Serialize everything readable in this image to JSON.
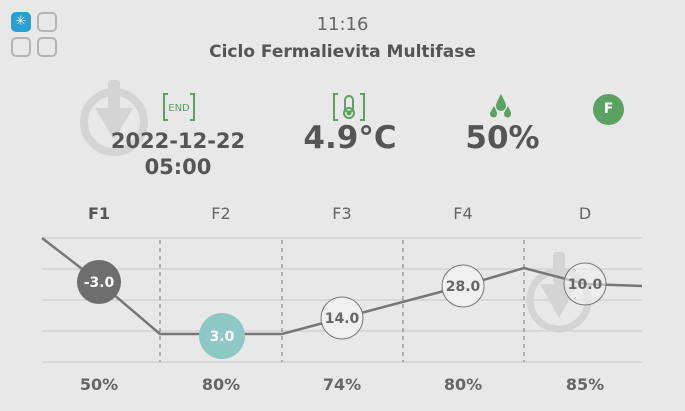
{
  "header": {
    "time": "11:16",
    "program_title": "Ciclo Fermalievita Multifase"
  },
  "status": {
    "end_icon_label": "END",
    "end_date": "2022-12-22",
    "end_time": "05:00",
    "temperature": "4.9°C",
    "humidity": "50%",
    "mode_badge": "F"
  },
  "phases": [
    {
      "label": "F1",
      "temp": "-3.0",
      "humidity": "50%",
      "active": true
    },
    {
      "label": "F2",
      "temp": "3.0",
      "humidity": "80%",
      "active": false
    },
    {
      "label": "F3",
      "temp": "14.0",
      "humidity": "74%",
      "active": false
    },
    {
      "label": "F4",
      "temp": "28.0",
      "humidity": "80%",
      "active": false
    },
    {
      "label": "D",
      "temp": "10.0",
      "humidity": "85%",
      "active": false
    }
  ],
  "colors": {
    "accent_blue": "#2a9fd6",
    "accent_green": "#5aa262",
    "phase2_teal": "#8ec8c4",
    "active_dark": "#6e6e6e"
  }
}
